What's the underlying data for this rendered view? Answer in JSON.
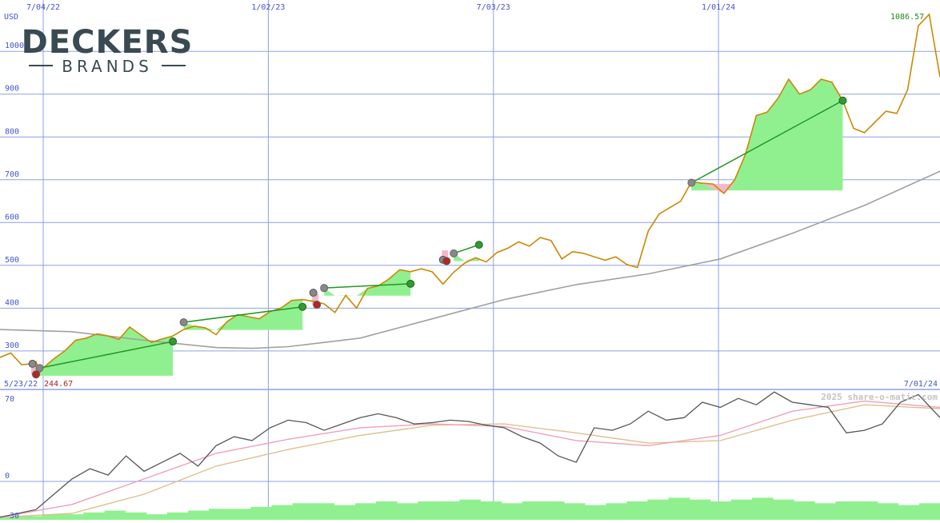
{
  "logo": {
    "word": "DECKERS",
    "sub": "BRANDS"
  },
  "watermark": "2025 share-o-matic.com",
  "colors": {
    "price": "#cc8800",
    "ma_long": "#a0a0a0",
    "grid": "#8fa0e8",
    "axis_text": "#4455cc",
    "gain_fill": "#90f090",
    "loss_fill": "#f4b8c8",
    "trade_line": "#229922",
    "buy_marker": "#888888",
    "win_marker": "#339933",
    "loss_marker": "#bb2222",
    "osc_line": "#555555",
    "osc_fast": "#f0a0b8",
    "osc_slow": "#e0c090",
    "volume": "#90f090",
    "high_label": "#228822",
    "low_label": "#aa2222"
  },
  "chart_data": [
    {
      "type": "line",
      "panel": "price",
      "unit_label": "USD",
      "y_ticks": [
        300,
        400,
        500,
        600,
        700,
        800,
        900,
        1000
      ],
      "ylim": [
        210,
        1120
      ],
      "x_tick_labels": [
        "7/04/22",
        "1/02/23",
        "7/03/23",
        "1/01/24"
      ],
      "start_label": "5/23/22",
      "end_label": "7/01/24",
      "high_label": "1086.57",
      "low_label": "244.67",
      "grid": true,
      "series": [
        {
          "role": "price",
          "x": [
            0,
            3,
            6,
            9,
            10,
            11,
            12,
            15,
            18,
            21,
            24,
            27,
            30,
            33,
            36,
            39,
            42,
            45,
            48,
            51,
            54,
            57,
            60,
            63,
            66,
            69,
            72,
            75,
            78,
            81,
            84,
            87,
            90,
            93,
            96,
            99,
            102,
            105,
            108,
            111,
            114,
            117,
            120,
            123,
            126,
            129,
            132,
            135,
            138,
            141,
            144,
            147,
            150,
            153,
            156,
            159,
            162,
            165,
            168,
            171,
            174,
            177,
            180,
            183,
            186,
            189,
            192,
            195,
            198,
            201,
            204,
            207,
            210,
            213,
            216,
            219,
            222,
            225,
            228,
            231,
            234,
            237,
            240,
            243,
            246,
            249,
            252,
            255,
            258,
            261
          ],
          "values": [
            285,
            295,
            268,
            270,
            275,
            249,
            260,
            282,
            300,
            325,
            330,
            340,
            335,
            327,
            356,
            338,
            320,
            328,
            335,
            350,
            358,
            354,
            338,
            368,
            385,
            380,
            375,
            392,
            400,
            418,
            420,
            416,
            410,
            390,
            430,
            400,
            446,
            452,
            468,
            490,
            485,
            492,
            485,
            456,
            484,
            505,
            518,
            508,
            530,
            540,
            555,
            545,
            565,
            558,
            515,
            532,
            528,
            520,
            512,
            520,
            502,
            495,
            580,
            620,
            635,
            650,
            695,
            692,
            690,
            668,
            700,
            760,
            850,
            858,
            890,
            935,
            900,
            910,
            935,
            928,
            885,
            820,
            810,
            835,
            860,
            855,
            910,
            1060,
            1086.57,
            940
          ]
        },
        {
          "role": "long moving average",
          "x": [
            0,
            20,
            40,
            60,
            70,
            80,
            100,
            120,
            140,
            160,
            180,
            200,
            220,
            240,
            261
          ],
          "values": [
            350,
            345,
            325,
            308,
            306,
            310,
            330,
            375,
            420,
            455,
            480,
            515,
            575,
            640,
            720
          ]
        }
      ],
      "trades": [
        {
          "buy_x": 11,
          "buy": 260,
          "sell_x": 48,
          "sell": 322,
          "result": "win"
        },
        {
          "buy_x": 51,
          "buy": 367,
          "sell_x": 84,
          "sell": 403,
          "result": "win"
        },
        {
          "buy_x": 90,
          "buy": 447,
          "sell_x": 114,
          "sell": 457,
          "result": "win"
        },
        {
          "buy_x": 126,
          "buy": 528,
          "sell_x": 133,
          "sell": 548,
          "result": "win"
        },
        {
          "buy_x": 192,
          "buy": 693,
          "sell_x": 234,
          "sell": 885,
          "result": "win"
        }
      ],
      "signal_markers": [
        {
          "x": 9,
          "value": 270,
          "kind": "buy"
        },
        {
          "x": 10,
          "value": 245,
          "kind": "loss"
        },
        {
          "x": 87,
          "value": 436,
          "kind": "buy"
        },
        {
          "x": 88,
          "value": 408,
          "kind": "loss"
        },
        {
          "x": 123,
          "value": 513,
          "kind": "buy"
        },
        {
          "x": 124,
          "value": 510,
          "kind": "loss"
        }
      ]
    },
    {
      "type": "line",
      "panel": "oscillator",
      "y_ticks": [
        -30,
        0,
        70
      ],
      "ylim": [
        -30,
        72
      ],
      "grid": true,
      "series": [
        {
          "role": "oscillator",
          "x": [
            0,
            5,
            10,
            15,
            20,
            25,
            30,
            35,
            40,
            45,
            50,
            55,
            60,
            65,
            70,
            75,
            80,
            85,
            90,
            95,
            100,
            105,
            110,
            115,
            120,
            125,
            130,
            135,
            140,
            145,
            150,
            155,
            160,
            165,
            170,
            175,
            180,
            185,
            190,
            195,
            200,
            205,
            210,
            215,
            220,
            225,
            230,
            235,
            240,
            245,
            250,
            255,
            261
          ],
          "values": [
            -28,
            -25,
            -22,
            -10,
            2,
            10,
            5,
            20,
            8,
            15,
            22,
            12,
            28,
            35,
            32,
            42,
            48,
            46,
            40,
            45,
            50,
            53,
            50,
            45,
            46,
            48,
            47,
            44,
            42,
            35,
            30,
            20,
            15,
            42,
            40,
            45,
            55,
            48,
            50,
            62,
            58,
            65,
            60,
            70,
            62,
            60,
            58,
            38,
            40,
            45,
            62,
            68,
            50
          ]
        },
        {
          "role": "fast average",
          "x": [
            0,
            20,
            40,
            60,
            80,
            100,
            120,
            140,
            160,
            180,
            200,
            220,
            240,
            261
          ],
          "values": [
            -28,
            -18,
            2,
            22,
            33,
            42,
            45,
            43,
            32,
            28,
            36,
            55,
            63,
            58
          ]
        },
        {
          "role": "slow average",
          "x": [
            0,
            20,
            40,
            60,
            80,
            100,
            120,
            140,
            160,
            180,
            200,
            220,
            240,
            261
          ],
          "values": [
            -28,
            -25,
            -10,
            12,
            25,
            36,
            44,
            45,
            38,
            30,
            32,
            48,
            60,
            57
          ]
        }
      ],
      "volume": [
        2,
        2,
        3,
        3,
        4,
        5,
        4,
        3,
        4,
        5,
        6,
        6,
        7,
        8,
        9,
        9,
        8,
        9,
        10,
        9,
        10,
        10,
        11,
        10,
        9,
        10,
        10,
        9,
        8,
        9,
        10,
        11,
        12,
        11,
        10,
        11,
        12,
        11,
        10,
        9,
        10,
        10,
        9,
        8,
        9
      ]
    }
  ]
}
